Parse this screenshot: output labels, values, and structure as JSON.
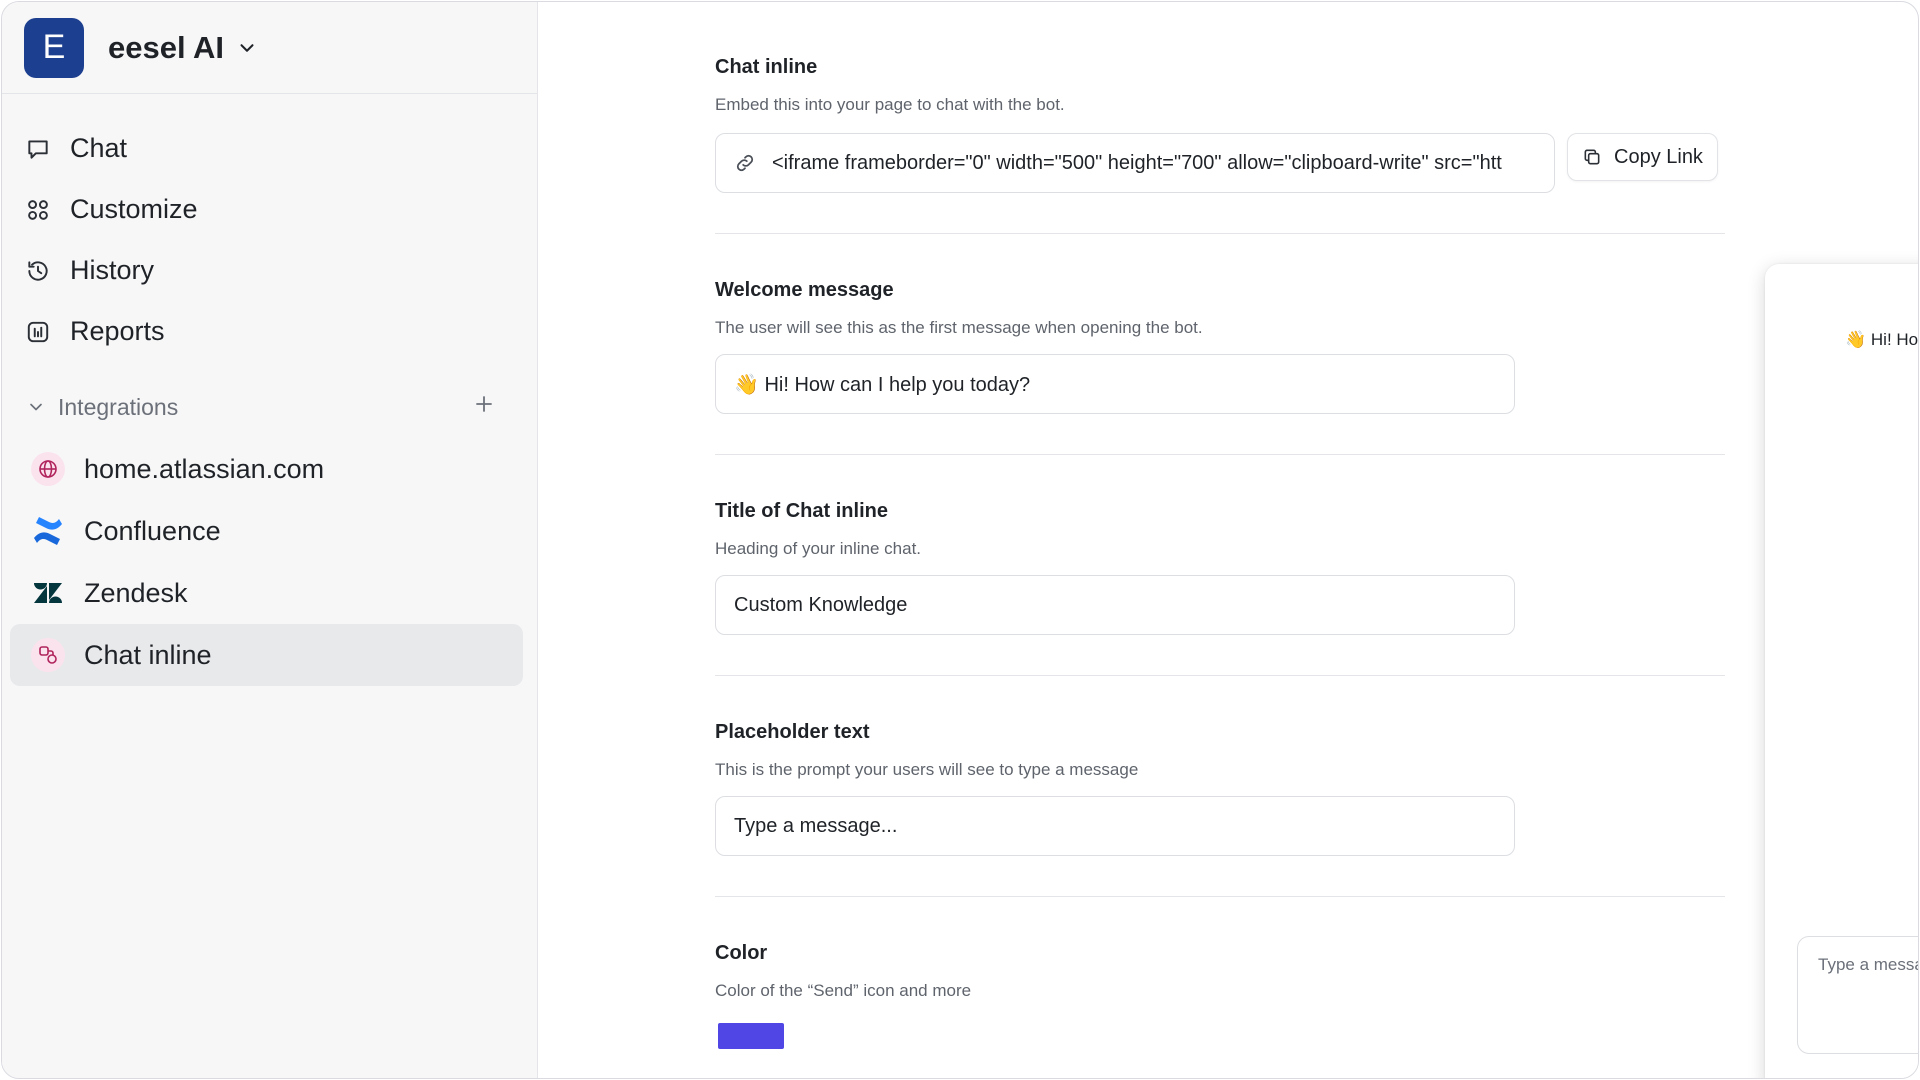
{
  "workspace": {
    "initial": "E",
    "name": "eesel AI"
  },
  "nav": [
    {
      "label": "Chat",
      "icon": "chat-bubble-icon"
    },
    {
      "label": "Customize",
      "icon": "grid-icon"
    },
    {
      "label": "History",
      "icon": "history-icon"
    },
    {
      "label": "Reports",
      "icon": "reports-icon"
    }
  ],
  "integrations": {
    "header": "Integrations",
    "items": [
      {
        "label": "home.atlassian.com",
        "icon": "globe-icon"
      },
      {
        "label": "Confluence",
        "icon": "confluence-icon"
      },
      {
        "label": "Zendesk",
        "icon": "zendesk-icon"
      },
      {
        "label": "Chat inline",
        "icon": "chat-inline-icon",
        "active": true
      }
    ]
  },
  "sections": {
    "embed": {
      "title": "Chat inline",
      "desc": "Embed this into your page to chat with the bot.",
      "code": "<iframe frameborder=\"0\" width=\"500\" height=\"700\" allow=\"clipboard-write\" src=\"htt",
      "copy_label": "Copy Link"
    },
    "welcome": {
      "title": "Welcome message",
      "desc": "The user will see this as the first message when opening the bot.",
      "value": "👋 Hi! How can I help you today?"
    },
    "chat_title": {
      "title": "Title of Chat inline",
      "desc": "Heading of your inline chat.",
      "value": "Custom Knowledge"
    },
    "placeholder": {
      "title": "Placeholder text",
      "desc": "This is the prompt your users will see to type a message",
      "value": "Type a message..."
    },
    "color": {
      "title": "Color",
      "desc": "Color of the “Send” icon and more",
      "value": "#4f46e5"
    }
  },
  "preview": {
    "welcome": "👋 Hi! How can I help you today?",
    "input_placeholder": "Type a message...",
    "send_color": "#4f46e5"
  }
}
